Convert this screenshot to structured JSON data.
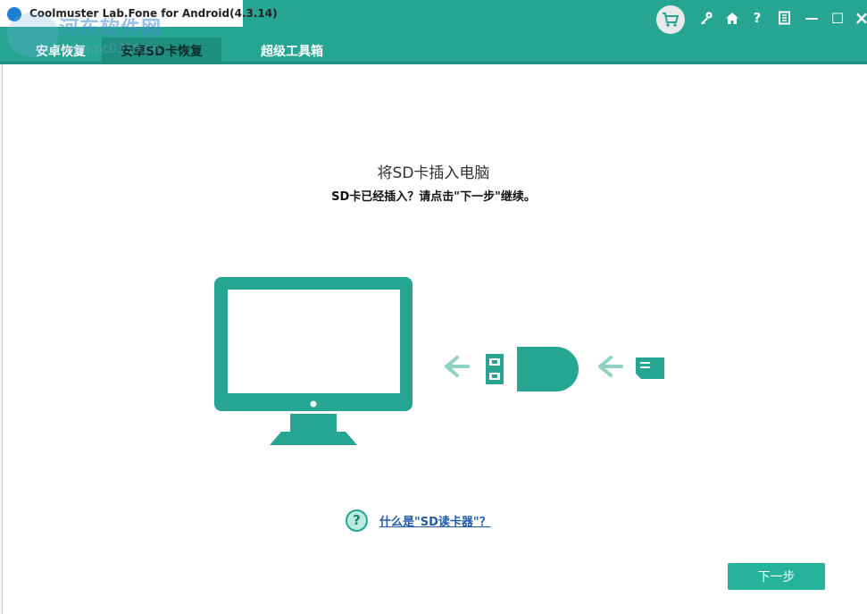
{
  "window": {
    "title": "Coolmuster Lab.Fone for Android(4.3.14)"
  },
  "watermark": {
    "text": "河东软件网",
    "url": "www.pc0359.cn"
  },
  "tabs": [
    {
      "label": "安卓恢复",
      "active": false
    },
    {
      "label": "安卓SD卡恢复",
      "active": true
    },
    {
      "label": "超级工具箱",
      "active": false
    }
  ],
  "toolbar": {
    "cart_icon": "shopping-cart-icon",
    "key_icon": "key-icon",
    "home_icon": "home-icon",
    "help_label": "?",
    "feedback_icon": "document-icon",
    "minimize_label": "—",
    "maximize_label": "☐",
    "close_label": "×"
  },
  "main": {
    "heading": "将SD卡插入电脑",
    "subheading": "SD卡已经插入？请点击\"下一步\"继续。",
    "help_icon_label": "?",
    "help_link": "什么是\"SD读卡器\"？",
    "next_button": "下一步"
  },
  "colors": {
    "accent": "#26a592",
    "button": "#26b39b",
    "link": "#1f5ca8"
  }
}
